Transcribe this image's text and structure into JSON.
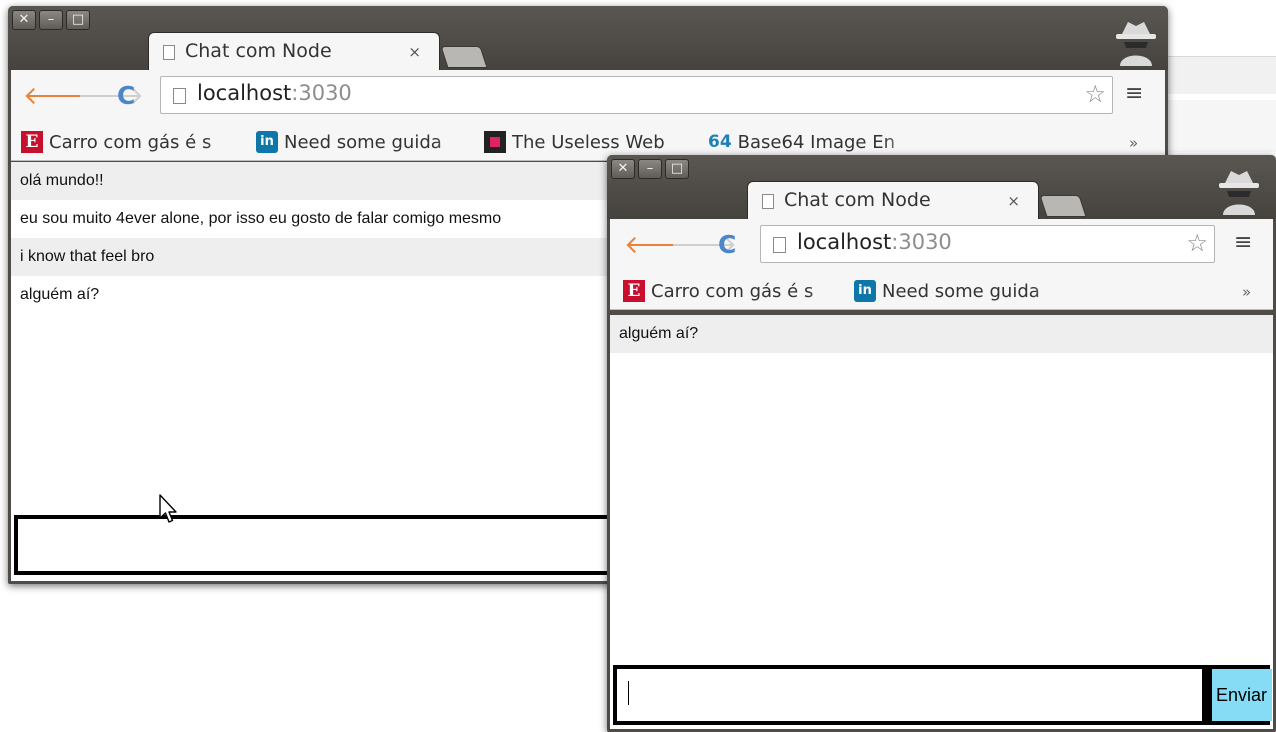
{
  "windows": [
    {
      "tab": {
        "title": "Chat com Node",
        "close": "×"
      },
      "controls": {
        "close": "✕",
        "minimize": "–",
        "maximize": "□"
      },
      "address": {
        "host": "localhost",
        "port": ":3030"
      },
      "bookmarks": [
        {
          "icon": "E",
          "label": "Carro com gás é s"
        },
        {
          "icon": "in",
          "label": "Need some guida"
        },
        {
          "icon": "",
          "label": "The Useless Web"
        },
        {
          "icon": "64",
          "label": "Base64 Image En"
        }
      ],
      "bookmarks_overflow": "»",
      "messages": [
        "olá mundo!!",
        "eu sou muito 4ever alone, por isso eu gosto de falar comigo mesmo",
        "i know that feel bro",
        "alguém aí?"
      ],
      "input": {
        "value": ""
      }
    },
    {
      "tab": {
        "title": "Chat com Node",
        "close": "×"
      },
      "controls": {
        "close": "✕",
        "minimize": "–",
        "maximize": "□"
      },
      "address": {
        "host": "localhost",
        "port": ":3030"
      },
      "bookmarks": [
        {
          "icon": "E",
          "label": "Carro com gás é s"
        },
        {
          "icon": "in",
          "label": "Need some guida"
        }
      ],
      "bookmarks_overflow": "»",
      "messages": [
        "alguém aí?"
      ],
      "input": {
        "value": ""
      },
      "send_label": "Enviar"
    }
  ],
  "colors": {
    "send_button": "#86dcf5",
    "back_arrow": "#e8833a",
    "reload": "#4a86c8",
    "alt_row": "#eeeeee"
  }
}
